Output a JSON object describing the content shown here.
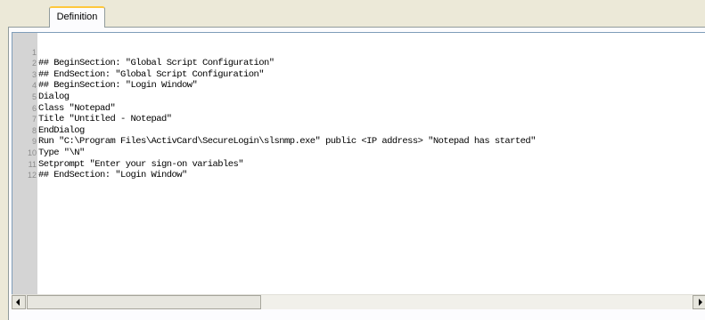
{
  "tab": {
    "label": "Definition"
  },
  "editor": {
    "lines": [
      {
        "num": "1",
        "text": "## BeginSection: \"Global Script Configuration\""
      },
      {
        "num": "2",
        "text": "## EndSection: \"Global Script Configuration\""
      },
      {
        "num": "3",
        "text": "## BeginSection: \"Login Window\""
      },
      {
        "num": "4",
        "text": "Dialog"
      },
      {
        "num": "5",
        "text": "Class \"Notepad\""
      },
      {
        "num": "6",
        "text": "Title \"Untitled - Notepad\""
      },
      {
        "num": "7",
        "text": "EndDialog"
      },
      {
        "num": "8",
        "text": "Run \"C:\\Program Files\\ActivCard\\SecureLogin\\slsnmp.exe\" public <IP address> \"Notepad has started\""
      },
      {
        "num": "9",
        "text": "Type \"\\N\""
      },
      {
        "num": "10",
        "text": "Setprompt \"Enter your sign-on variables\""
      },
      {
        "num": "11",
        "text": "## EndSection: \"Login Window\""
      },
      {
        "num": "12",
        "text": ""
      }
    ]
  },
  "scrollbar": {
    "left_icon": "arrow-left-icon",
    "right_icon": "arrow-right-icon"
  },
  "colors": {
    "tab_highlight": "#ffc83c",
    "editor_border": "#7f9db9",
    "gutter": "#d4d4d4",
    "window_bg": "#ece9d8"
  }
}
